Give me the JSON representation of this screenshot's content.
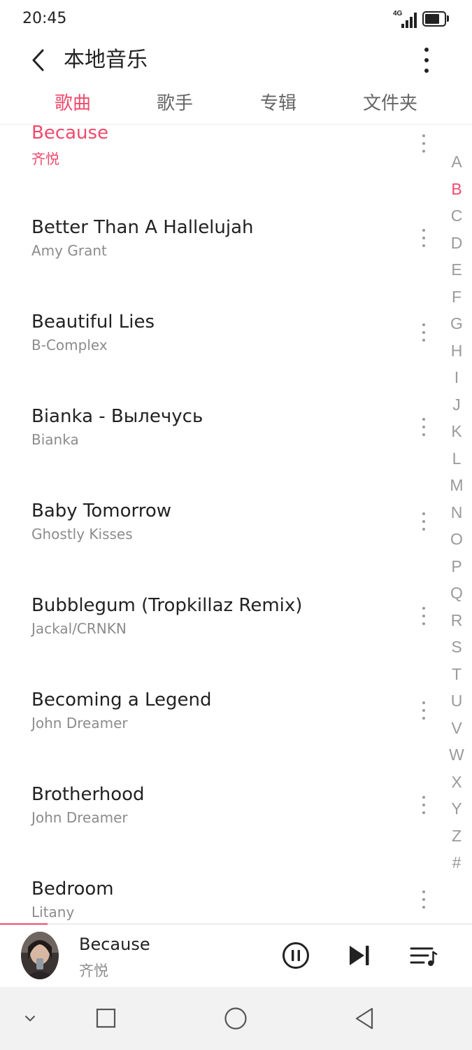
{
  "status_bar": {
    "time": "20:45",
    "network": "4G",
    "icons": [
      "signal-icon",
      "battery-icon"
    ]
  },
  "header": {
    "title": "本地音乐",
    "back_icon": "back-arrow-icon",
    "more_icon": "more-vertical-icon"
  },
  "tabs": [
    {
      "label": "歌曲",
      "active": true
    },
    {
      "label": "歌手",
      "active": false
    },
    {
      "label": "专辑",
      "active": false
    },
    {
      "label": "文件夹",
      "active": false
    }
  ],
  "songs": [
    {
      "title": "Because",
      "artist": "齐悦",
      "playing": true
    },
    {
      "title": "Better Than A Hallelujah",
      "artist": "Amy Grant",
      "playing": false
    },
    {
      "title": "Beautiful Lies",
      "artist": "B-Complex",
      "playing": false
    },
    {
      "title": "Bianka - Вылечусь",
      "artist": "Bianka",
      "playing": false
    },
    {
      "title": "Baby Tomorrow",
      "artist": "Ghostly Kisses",
      "playing": false
    },
    {
      "title": "Bubblegum (Tropkillaz Remix)",
      "artist": "Jackal/CRNKN",
      "playing": false
    },
    {
      "title": "Becoming a Legend",
      "artist": "John Dreamer",
      "playing": false
    },
    {
      "title": "Brotherhood",
      "artist": "John Dreamer",
      "playing": false
    },
    {
      "title": "Bedroom",
      "artist": "Litany",
      "playing": false
    }
  ],
  "index_bar": {
    "letters": [
      "A",
      "B",
      "C",
      "D",
      "E",
      "F",
      "G",
      "H",
      "I",
      "J",
      "K",
      "L",
      "M",
      "N",
      "O",
      "P",
      "Q",
      "R",
      "S",
      "T",
      "U",
      "V",
      "W",
      "X",
      "Y",
      "Z",
      "#"
    ],
    "active": "B"
  },
  "now_playing": {
    "title": "Because",
    "artist": "齐悦",
    "progress": 0.1,
    "controls": [
      "pause-icon",
      "next-track-icon",
      "playlist-icon"
    ]
  },
  "nav_bar": {
    "buttons": [
      "chevron-down-icon",
      "recents-square-icon",
      "home-circle-icon",
      "back-triangle-icon"
    ]
  },
  "colors": {
    "accent": "#f04a6b",
    "text_primary": "#222222",
    "text_secondary": "#8c8c8c",
    "nav_bg": "#f2f2f2"
  }
}
